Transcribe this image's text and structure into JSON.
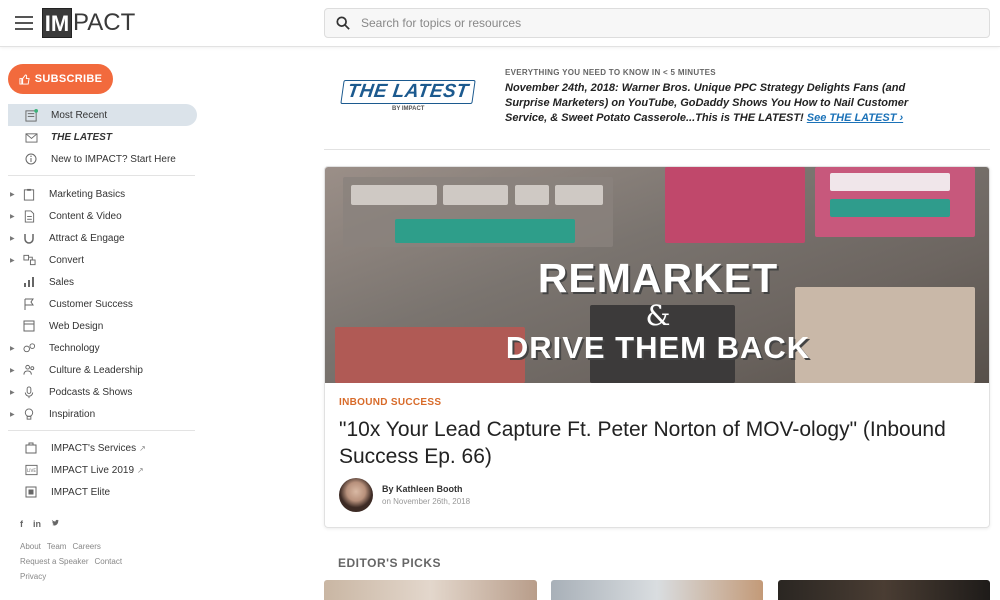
{
  "header": {
    "logo_box": "IM",
    "logo_text": "PACT",
    "search_placeholder": "Search for topics or resources"
  },
  "sidebar": {
    "subscribe_label": "SUBSCRIBE",
    "top_items": [
      {
        "label": "Most Recent",
        "icon": "newspaper-icon"
      },
      {
        "label": "THE LATEST",
        "icon": "envelope-icon"
      },
      {
        "label": "New to IMPACT? Start Here",
        "icon": "info-icon"
      }
    ],
    "categories": [
      {
        "label": "Marketing Basics",
        "icon": "clipboard-icon"
      },
      {
        "label": "Content & Video",
        "icon": "document-icon"
      },
      {
        "label": "Attract & Engage",
        "icon": "magnet-icon"
      },
      {
        "label": "Convert",
        "icon": "convert-icon"
      },
      {
        "label": "Sales",
        "icon": "bar-chart-icon"
      },
      {
        "label": "Customer Success",
        "icon": "flag-icon"
      },
      {
        "label": "Web Design",
        "icon": "browser-icon"
      },
      {
        "label": "Technology",
        "icon": "gears-icon"
      },
      {
        "label": "Culture & Leadership",
        "icon": "people-icon"
      },
      {
        "label": "Podcasts & Shows",
        "icon": "microphone-icon"
      },
      {
        "label": "Inspiration",
        "icon": "lightbulb-icon"
      }
    ],
    "services": [
      {
        "label": "IMPACT's Services",
        "icon": "briefcase-icon"
      },
      {
        "label": "IMPACT Live 2019",
        "icon": "live-icon"
      },
      {
        "label": "IMPACT Elite",
        "icon": "elite-icon"
      }
    ],
    "social": [
      "f",
      "in",
      "t"
    ],
    "footer_row1": [
      "About",
      "Team",
      "Careers"
    ],
    "footer_row2": [
      "Request a Speaker",
      "Contact"
    ],
    "footer_row3": [
      "Privacy"
    ]
  },
  "latest": {
    "logo": "THE LATEST",
    "logo_by": "BY IMPACT",
    "kicker": "EVERYTHING YOU NEED TO KNOW IN < 5 MINUTES",
    "text": "November 24th, 2018: Warner Bros. Unique PPC Strategy Delights Fans (and Surprise Marketers) on YouTube, GoDaddy Shows You How to Nail Customer Service, & Sweet Potato Casserole...This is THE LATEST!",
    "link": "See THE LATEST ›"
  },
  "feature": {
    "hero_line1": "REMARKET",
    "hero_amp": "&",
    "hero_line2": "DRIVE THEM BACK",
    "tag": "INBOUND SUCCESS",
    "title": "\"10x Your Lead Capture Ft. Peter Norton of MOV-ology\" (Inbound Success Ep. 66)",
    "author": "By Kathleen Booth",
    "date": "on November 26th, 2018"
  },
  "editors_picks": "EDITOR'S PICKS",
  "colors": {
    "accent": "#f26a3d",
    "tag": "#d86b2a",
    "link": "#1b72b8",
    "active": "#dbe3ea"
  }
}
